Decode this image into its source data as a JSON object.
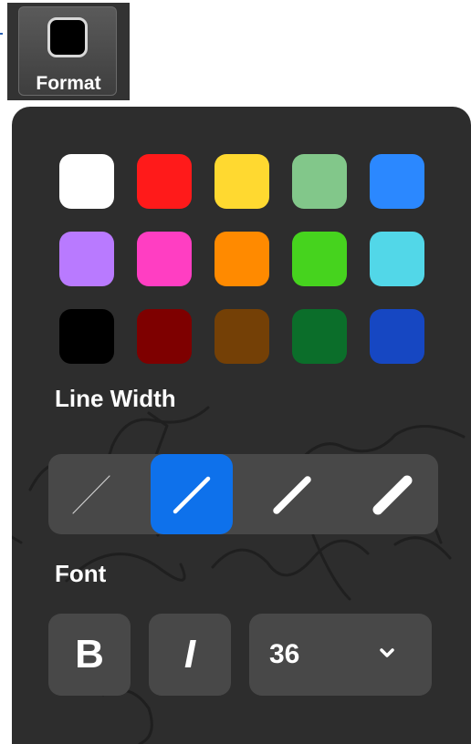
{
  "toolbar": {
    "format_label": "Format",
    "format_icon": "color-swatch-icon",
    "current_color": "#000000"
  },
  "panel": {
    "colors": [
      "#ffffff",
      "#ff1a1a",
      "#ffd930",
      "#82c78a",
      "#2b88ff",
      "#b97aff",
      "#ff3ec2",
      "#ff8a00",
      "#46d31e",
      "#52d7e8",
      "#000000",
      "#7e0000",
      "#744006",
      "#0b6e2a",
      "#1647c2"
    ],
    "line_width": {
      "title": "Line Width",
      "options": [
        "hairline",
        "thin",
        "medium",
        "thick"
      ],
      "selected": "thin"
    },
    "font": {
      "title": "Font",
      "bold_label": "B",
      "italic_label": "I",
      "size_value": "36",
      "size_dropdown_icon": "chevron-down-icon"
    }
  },
  "colors": {
    "panel_bg": "#2d2d2d",
    "control_bg": "#484848",
    "accent": "#0e71eb",
    "text": "#ffffff"
  }
}
